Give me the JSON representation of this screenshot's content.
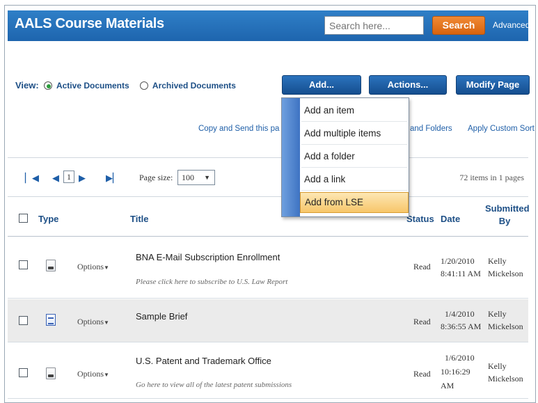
{
  "header": {
    "title": "AALS Course Materials",
    "search_placeholder": "Search here...",
    "search_button": "Search",
    "advanced_link": "Advanced"
  },
  "view": {
    "label": "View:",
    "options": [
      {
        "label": "Active Documents",
        "selected": true
      },
      {
        "label": "Archived Documents",
        "selected": false
      }
    ]
  },
  "toolbar": {
    "add": "Add...",
    "actions": "Actions...",
    "modify": "Modify Page"
  },
  "links": {
    "copy_send": "Copy and Send this pa",
    "items_folders": "s and Folders",
    "custom_sort": "Apply Custom Sort"
  },
  "pager": {
    "current_page": "1",
    "page_size_label": "Page size:",
    "page_size": "100",
    "count": "72 items in 1 pages"
  },
  "table": {
    "columns": {
      "type": "Type",
      "title": "Title",
      "status": "Status",
      "date": "Date",
      "submitted_by": "Submitted By"
    },
    "options_label": "Options",
    "rows": [
      {
        "icon": "document-icon",
        "title": "BNA E-Mail Subscription Enrollment",
        "description": "Please click here to subscribe to U.S. Law Report",
        "status": "Read",
        "date": "1/20/2010",
        "time": "8:41:11 AM",
        "submitter_first": "Kelly",
        "submitter_last": "Mickelson"
      },
      {
        "icon": "word-document-icon",
        "title": "Sample Brief",
        "description": "",
        "status": "Read",
        "date": "1/4/2010",
        "time": "8:36:55 AM",
        "submitter_first": "Kelly",
        "submitter_last": "Mickelson"
      },
      {
        "icon": "document-icon",
        "title": "U.S. Patent and Trademark Office",
        "description": "Go here to view all of the latest patent submissions",
        "status": "Read",
        "date": "1/6/2010",
        "time_line1": "10:16:29",
        "time_line2": "AM",
        "submitter_first": "Kelly",
        "submitter_last": "Mickelson"
      }
    ]
  },
  "add_menu": {
    "items": [
      "Add an item",
      "Add multiple items",
      "Add a folder",
      "Add a link",
      "Add from LSE"
    ],
    "highlighted": "Add from LSE"
  },
  "colors": {
    "header_blue": "#1e65ae",
    "search_orange": "#d8630f",
    "button_blue": "#154e8f",
    "menu_highlight": "#f7c66a"
  }
}
